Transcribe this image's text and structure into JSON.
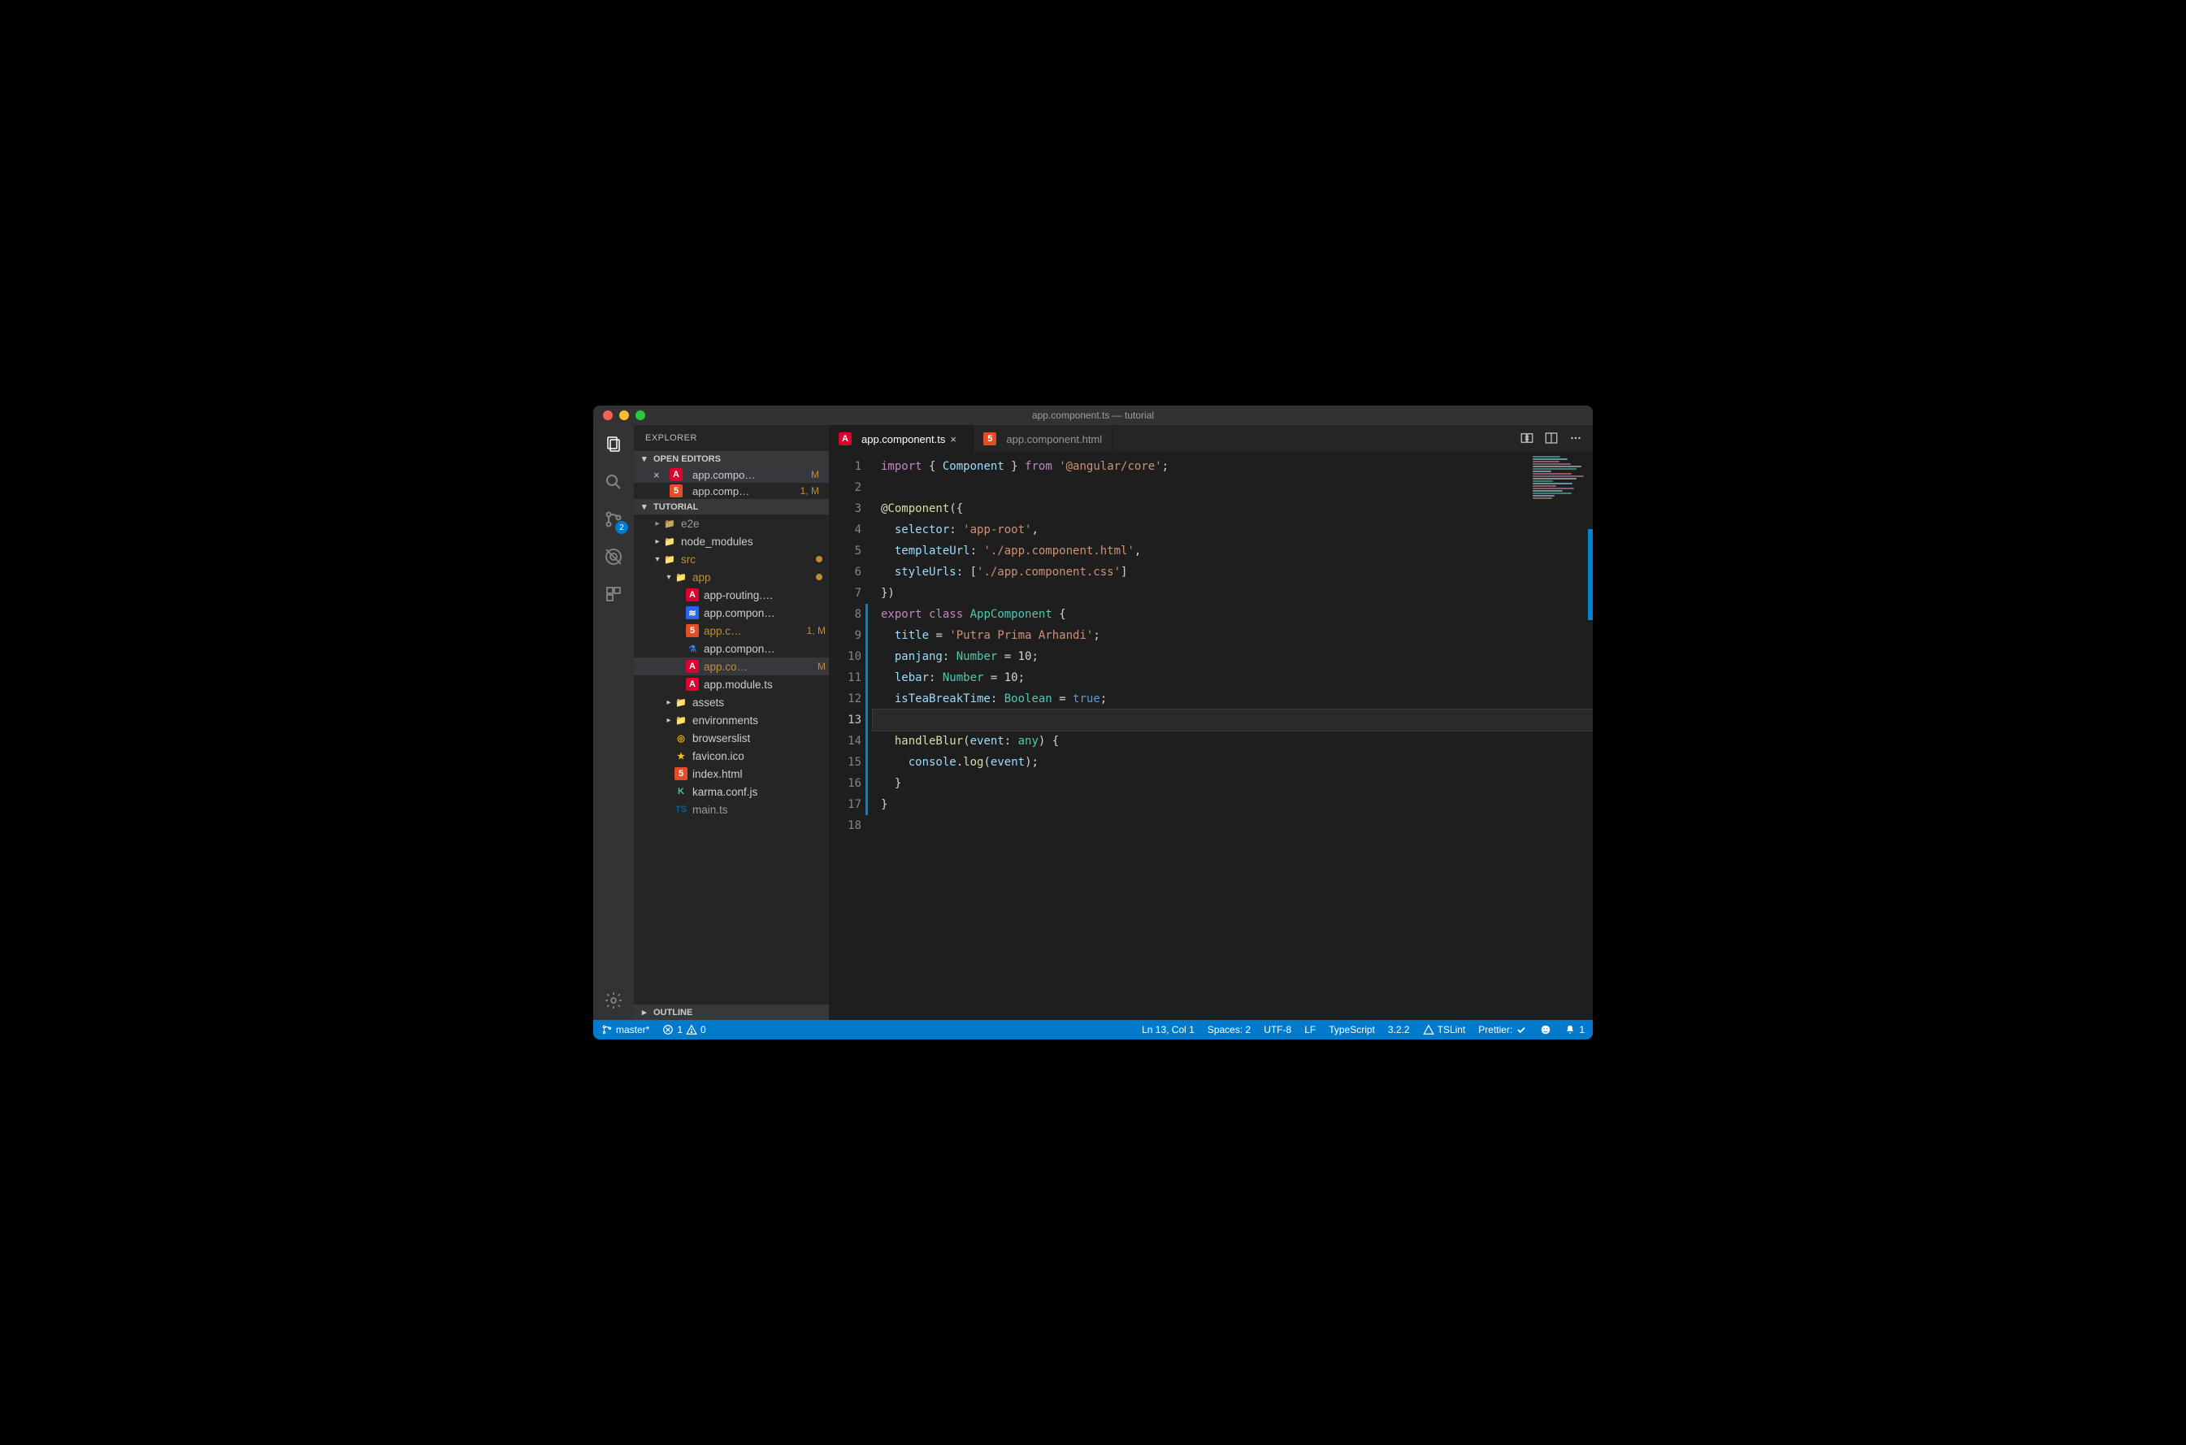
{
  "window": {
    "title": "app.component.ts — tutorial"
  },
  "sidebar": {
    "title": "EXPLORER",
    "open_editors_label": "OPEN EDITORS",
    "project_label": "TUTORIAL",
    "outline_label": "OUTLINE",
    "open_editors": [
      {
        "name": "app.compo…",
        "badge": "M",
        "icon": "ng",
        "active": true
      },
      {
        "name": "app.comp…",
        "badge": "1, M",
        "icon": "html",
        "active": false
      }
    ],
    "tree": [
      {
        "depth": 1,
        "name": "e2e",
        "icon": "folder-green",
        "expandable": true,
        "open": false,
        "mod": false,
        "cut": true
      },
      {
        "depth": 1,
        "name": "node_modules",
        "icon": "folder-green",
        "expandable": true,
        "open": false,
        "mod": false
      },
      {
        "depth": 1,
        "name": "src",
        "icon": "folder-green",
        "expandable": true,
        "open": true,
        "mod": true,
        "dot": true
      },
      {
        "depth": 2,
        "name": "app",
        "icon": "folder-red",
        "expandable": true,
        "open": true,
        "mod": true,
        "dot": true
      },
      {
        "depth": 3,
        "name": "app-routing.…",
        "icon": "ng",
        "mod": false
      },
      {
        "depth": 3,
        "name": "app.compon…",
        "icon": "css",
        "mod": false
      },
      {
        "depth": 3,
        "name": "app.c…",
        "icon": "html",
        "mod": true,
        "badge": "1, M"
      },
      {
        "depth": 3,
        "name": "app.compon…",
        "icon": "spec",
        "mod": false
      },
      {
        "depth": 3,
        "name": "app.co…",
        "icon": "ng",
        "mod": true,
        "badge": "M",
        "selected": true
      },
      {
        "depth": 3,
        "name": "app.module.ts",
        "icon": "ng",
        "mod": false
      },
      {
        "depth": 2,
        "name": "assets",
        "icon": "folder",
        "expandable": true,
        "open": false
      },
      {
        "depth": 2,
        "name": "environments",
        "icon": "folder-green",
        "expandable": true,
        "open": false
      },
      {
        "depth": 2,
        "name": "browserslist",
        "icon": "target"
      },
      {
        "depth": 2,
        "name": "favicon.ico",
        "icon": "star"
      },
      {
        "depth": 2,
        "name": "index.html",
        "icon": "html"
      },
      {
        "depth": 2,
        "name": "karma.conf.js",
        "icon": "karma"
      },
      {
        "depth": 2,
        "name": "main.ts",
        "icon": "ts",
        "cut": true
      }
    ]
  },
  "activity": {
    "scm_badge": "2"
  },
  "tabs": [
    {
      "label": "app.component.ts",
      "icon": "ng",
      "active": true,
      "dirty": true
    },
    {
      "label": "app.component.html",
      "icon": "html",
      "active": false,
      "dirty": false
    }
  ],
  "editor": {
    "cursor_line": 13,
    "lines": [
      [
        [
          "kw",
          "import"
        ],
        [
          "pn",
          " { "
        ],
        [
          "id",
          "Component"
        ],
        [
          "pn",
          " } "
        ],
        [
          "kw",
          "from"
        ],
        [
          "pn",
          " "
        ],
        [
          "str",
          "'@angular/core'"
        ],
        [
          "pn",
          ";"
        ]
      ],
      [],
      [
        [
          "dec",
          "@Component"
        ],
        [
          "pn",
          "({"
        ]
      ],
      [
        [
          "pn",
          "  "
        ],
        [
          "id",
          "selector"
        ],
        [
          "pn",
          ": "
        ],
        [
          "str",
          "'app-root'"
        ],
        [
          "pn",
          ","
        ]
      ],
      [
        [
          "pn",
          "  "
        ],
        [
          "id",
          "templateUrl"
        ],
        [
          "pn",
          ": "
        ],
        [
          "str",
          "'./app.component.html'"
        ],
        [
          "pn",
          ","
        ]
      ],
      [
        [
          "pn",
          "  "
        ],
        [
          "id",
          "styleUrls"
        ],
        [
          "pn",
          ": ["
        ],
        [
          "str",
          "'./app.component.css'"
        ],
        [
          "pn",
          "]"
        ]
      ],
      [
        [
          "pn",
          "})"
        ]
      ],
      [
        [
          "kw",
          "export"
        ],
        [
          "pn",
          " "
        ],
        [
          "kw",
          "class"
        ],
        [
          "pn",
          " "
        ],
        [
          "ty",
          "AppComponent"
        ],
        [
          "pn",
          " {"
        ]
      ],
      [
        [
          "pn",
          "  "
        ],
        [
          "id",
          "title"
        ],
        [
          "pn",
          " = "
        ],
        [
          "str",
          "'Putra Prima Arhandi'"
        ],
        [
          "pn",
          ";"
        ]
      ],
      [
        [
          "pn",
          "  "
        ],
        [
          "id",
          "panjang"
        ],
        [
          "pn",
          ": "
        ],
        [
          "ty",
          "Number"
        ],
        [
          "pn",
          " = 10;"
        ]
      ],
      [
        [
          "pn",
          "  "
        ],
        [
          "id",
          "lebar"
        ],
        [
          "pn",
          ": "
        ],
        [
          "ty",
          "Number"
        ],
        [
          "pn",
          " = 10;"
        ]
      ],
      [
        [
          "pn",
          "  "
        ],
        [
          "id",
          "isTeaBreakTime"
        ],
        [
          "pn",
          ": "
        ],
        [
          "ty",
          "Boolean"
        ],
        [
          "pn",
          " = "
        ],
        [
          "bool",
          "true"
        ],
        [
          "pn",
          ";"
        ]
      ],
      [],
      [
        [
          "pn",
          "  "
        ],
        [
          "fn",
          "handleBlur"
        ],
        [
          "pn",
          "("
        ],
        [
          "id",
          "event"
        ],
        [
          "pn",
          ": "
        ],
        [
          "ty",
          "any"
        ],
        [
          "pn",
          ") {"
        ]
      ],
      [
        [
          "pn",
          "    "
        ],
        [
          "id",
          "console"
        ],
        [
          "pn",
          "."
        ],
        [
          "fn",
          "log"
        ],
        [
          "pn",
          "("
        ],
        [
          "id",
          "event"
        ],
        [
          "pn",
          ");"
        ]
      ],
      [
        [
          "pn",
          "  }"
        ]
      ],
      [
        [
          "pn",
          "}"
        ]
      ],
      []
    ]
  },
  "status": {
    "branch": "master*",
    "errors": "1",
    "warnings": "0",
    "position": "Ln 13, Col 1",
    "spaces": "Spaces: 2",
    "encoding": "UTF-8",
    "eol": "LF",
    "lang": "TypeScript",
    "ts_version": "3.2.2",
    "tslint": "TSLint",
    "prettier": "Prettier:",
    "bell": "1"
  }
}
